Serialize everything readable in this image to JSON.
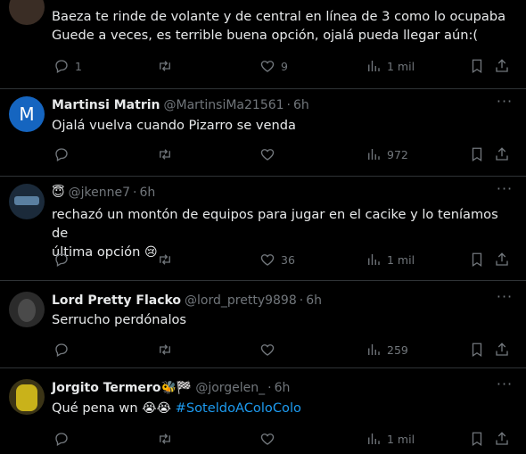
{
  "tweets": [
    {
      "id": "t1",
      "name": "",
      "handle": "",
      "time": "",
      "text": "Baeza te rinde de volante y de central en línea de 3 como lo ocupaba Guede a veces, es terrible buena opción, ojalá pueda llegar aún:(",
      "replies": "1",
      "retweets": "",
      "likes": "9",
      "views": "1 mil"
    },
    {
      "id": "t2",
      "name": "Martinsi Matrin",
      "handle": "@MartinsiMa21561",
      "dot": "·",
      "time": "6h",
      "avatar_letter": "M",
      "text": "Ojalá vuelva cuando Pizarro se venda",
      "replies": "",
      "retweets": "",
      "likes": "",
      "views": "972"
    },
    {
      "id": "t3",
      "name": "",
      "name_emoji": "😇",
      "handle": "@jkenne7",
      "dot": "·",
      "time": "6h",
      "text_line1": "rechazó un montón de equipos para jugar en el cacike  y lo teníamos de",
      "text_line2": "última opción",
      "text_emoji": "😢",
      "replies": "",
      "retweets": "",
      "likes": "36",
      "views": "1 mil"
    },
    {
      "id": "t4",
      "name": "Lord Pretty Flacko",
      "handle": "@lord_pretty9898",
      "dot": "·",
      "time": "6h",
      "text": "Serrucho perdónalos",
      "replies": "",
      "retweets": "",
      "likes": "",
      "views": "259"
    },
    {
      "id": "t5",
      "name": "Jorgito Termero",
      "name_emojis": "🐝🏁",
      "handle": "@jorgelen_",
      "dot": "·",
      "time": "6h",
      "text": "Qué pena wn",
      "text_emojis": "😭😭",
      "hashtag": "#SoteldoAColoColo",
      "replies": "",
      "retweets": "",
      "likes": "",
      "views": "1 mil"
    }
  ],
  "more_label": "···",
  "colors": {
    "background": "#000000",
    "text": "#e7e9ea",
    "muted": "#71767b",
    "link": "#1d9bf0",
    "divider": "#2f3336",
    "avatar_m": "#1565c0"
  },
  "icons": [
    "reply-icon",
    "retweet-icon",
    "like-icon",
    "views-icon",
    "bookmark-icon",
    "share-icon",
    "more-icon"
  ]
}
